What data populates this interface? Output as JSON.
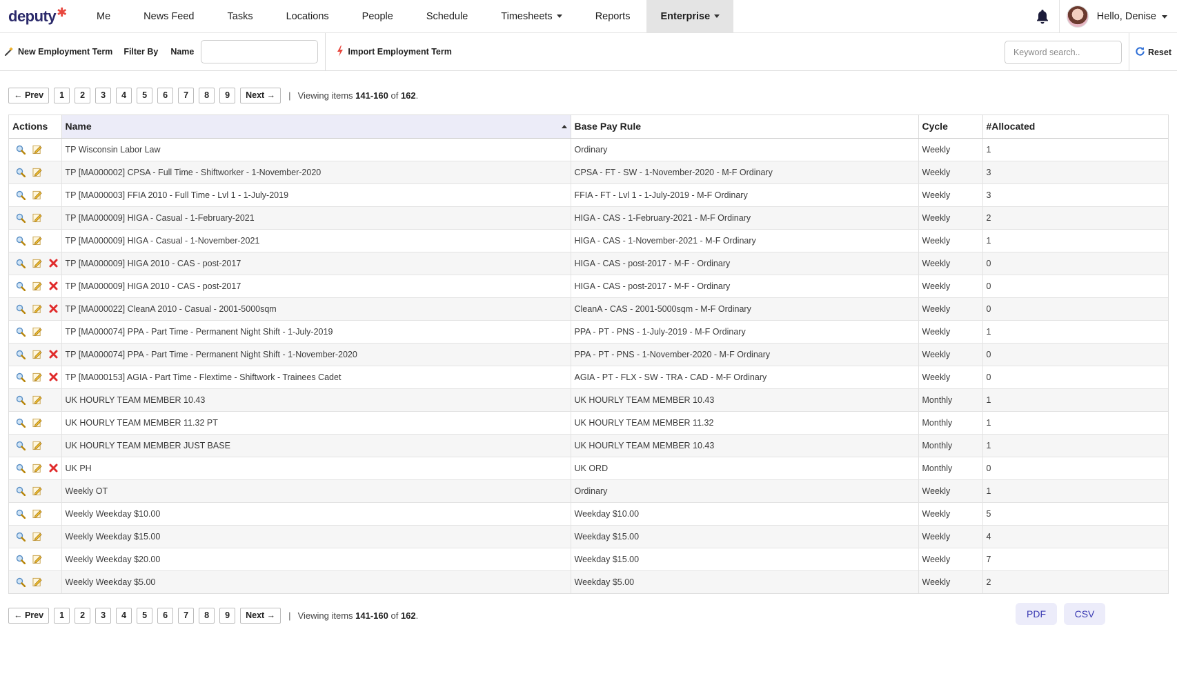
{
  "logo": {
    "text": "deputy",
    "star": "✱"
  },
  "nav": {
    "items": [
      {
        "label": "Me"
      },
      {
        "label": "News Feed"
      },
      {
        "label": "Tasks"
      },
      {
        "label": "Locations"
      },
      {
        "label": "People"
      },
      {
        "label": "Schedule"
      },
      {
        "label": "Timesheets",
        "dropdown": true
      },
      {
        "label": "Reports"
      },
      {
        "label": "Enterprise",
        "dropdown": true,
        "active": true
      }
    ],
    "greeting": "Hello, Denise"
  },
  "toolbar": {
    "new_term": "New Employment Term",
    "filter_by": "Filter By",
    "name_label": "Name",
    "import_term": "Import Employment Term",
    "search_placeholder": "Keyword search..",
    "reset": "Reset"
  },
  "pager": {
    "prev": "← Prev",
    "next": "Next →",
    "pages": [
      "1",
      "2",
      "3",
      "4",
      "5",
      "6",
      "7",
      "8",
      "9"
    ],
    "sep": "|",
    "viewing_prefix": "Viewing items ",
    "range": "141-160",
    "of": " of ",
    "total": "162",
    "suffix": "."
  },
  "table": {
    "headers": {
      "actions": "Actions",
      "name": "Name",
      "base_pay_rule": "Base Pay Rule",
      "cycle": "Cycle",
      "allocated": "#Allocated"
    },
    "rows": [
      {
        "name": "TP Wisconsin Labor Law",
        "rule": "Ordinary",
        "cycle": "Weekly",
        "allocated": "1",
        "deletable": false
      },
      {
        "name": "TP [MA000002] CPSA - Full Time - Shiftworker - 1-November-2020",
        "rule": "CPSA - FT - SW - 1-November-2020 - M-F Ordinary",
        "cycle": "Weekly",
        "allocated": "3",
        "deletable": false
      },
      {
        "name": "TP [MA000003] FFIA 2010 - Full Time - Lvl 1 - 1-July-2019",
        "rule": "FFIA - FT - Lvl 1 - 1-July-2019 - M-F Ordinary",
        "cycle": "Weekly",
        "allocated": "3",
        "deletable": false
      },
      {
        "name": "TP [MA000009] HIGA - Casual - 1-February-2021",
        "rule": "HIGA - CAS - 1-February-2021 - M-F Ordinary",
        "cycle": "Weekly",
        "allocated": "2",
        "deletable": false
      },
      {
        "name": "TP [MA000009] HIGA - Casual - 1-November-2021",
        "rule": "HIGA - CAS - 1-November-2021 - M-F Ordinary",
        "cycle": "Weekly",
        "allocated": "1",
        "deletable": false
      },
      {
        "name": "TP [MA000009] HIGA 2010 - CAS - post-2017",
        "rule": "HIGA - CAS - post-2017 - M-F - Ordinary",
        "cycle": "Weekly",
        "allocated": "0",
        "deletable": true
      },
      {
        "name": "TP [MA000009] HIGA 2010 - CAS - post-2017",
        "rule": "HIGA - CAS - post-2017 - M-F - Ordinary",
        "cycle": "Weekly",
        "allocated": "0",
        "deletable": true
      },
      {
        "name": "TP [MA000022] CleanA 2010 - Casual - 2001-5000sqm",
        "rule": "CleanA - CAS - 2001-5000sqm - M-F Ordinary",
        "cycle": "Weekly",
        "allocated": "0",
        "deletable": true
      },
      {
        "name": "TP [MA000074] PPA - Part Time - Permanent Night Shift - 1-July-2019",
        "rule": "PPA - PT - PNS - 1-July-2019 - M-F Ordinary",
        "cycle": "Weekly",
        "allocated": "1",
        "deletable": false
      },
      {
        "name": "TP [MA000074] PPA - Part Time - Permanent Night Shift - 1-November-2020",
        "rule": "PPA - PT - PNS - 1-November-2020 - M-F Ordinary",
        "cycle": "Weekly",
        "allocated": "0",
        "deletable": true
      },
      {
        "name": "TP [MA000153] AGIA - Part Time - Flextime - Shiftwork - Trainees Cadet",
        "rule": "AGIA - PT - FLX - SW - TRA - CAD - M-F Ordinary",
        "cycle": "Weekly",
        "allocated": "0",
        "deletable": true
      },
      {
        "name": "UK HOURLY TEAM MEMBER 10.43",
        "rule": "UK HOURLY TEAM MEMBER 10.43",
        "cycle": "Monthly",
        "allocated": "1",
        "deletable": false
      },
      {
        "name": "UK HOURLY TEAM MEMBER 11.32 PT",
        "rule": "UK HOURLY TEAM MEMBER 11.32",
        "cycle": "Monthly",
        "allocated": "1",
        "deletable": false
      },
      {
        "name": "UK HOURLY TEAM MEMBER JUST BASE",
        "rule": "UK HOURLY TEAM MEMBER 10.43",
        "cycle": "Monthly",
        "allocated": "1",
        "deletable": false
      },
      {
        "name": "UK PH",
        "rule": "UK ORD",
        "cycle": "Monthly",
        "allocated": "0",
        "deletable": true
      },
      {
        "name": "Weekly OT",
        "rule": "Ordinary",
        "cycle": "Weekly",
        "allocated": "1",
        "deletable": false
      },
      {
        "name": "Weekly Weekday $10.00",
        "rule": "Weekday $10.00",
        "cycle": "Weekly",
        "allocated": "5",
        "deletable": false
      },
      {
        "name": "Weekly Weekday $15.00",
        "rule": "Weekday $15.00",
        "cycle": "Weekly",
        "allocated": "4",
        "deletable": false
      },
      {
        "name": "Weekly Weekday $20.00",
        "rule": "Weekday $15.00",
        "cycle": "Weekly",
        "allocated": "7",
        "deletable": false
      },
      {
        "name": "Weekly Weekday $5.00",
        "rule": "Weekday $5.00",
        "cycle": "Weekly",
        "allocated": "2",
        "deletable": false
      }
    ]
  },
  "exports": {
    "pdf": "PDF",
    "csv": "CSV"
  },
  "colors": {
    "brand": "#2b2a6b",
    "brand_star": "#e8483f",
    "export_text": "#3b3bb3",
    "delete_red": "#e02b2b"
  },
  "icons": {
    "view": "magnifier-icon",
    "edit": "pencil-icon",
    "delete": "delete-x-icon",
    "bell": "bell-icon",
    "import": "lightning-icon",
    "reset": "refresh-icon"
  }
}
